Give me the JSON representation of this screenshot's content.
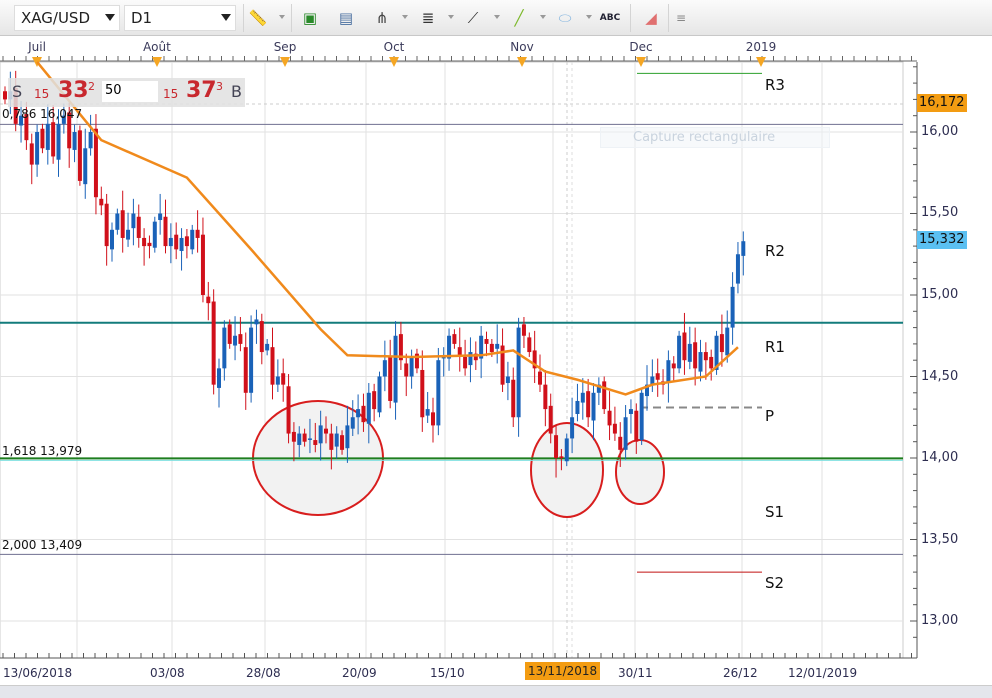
{
  "toolbar": {
    "symbol": "XAG/USD",
    "timeframe": "D1",
    "icons": [
      "ruler-icon",
      "add-image-icon",
      "chart-window-icon",
      "fork-icon",
      "indicator-list-icon",
      "fan-icon",
      "line-tool-icon",
      "ellipse-icon",
      "text-tool-icon",
      "eraser-icon",
      "menu-icon"
    ]
  },
  "months": [
    "Juil",
    "Août",
    "Sep",
    "Oct",
    "Nov",
    "Dec",
    "2019"
  ],
  "info_panel": {
    "sell_label": "S",
    "sell_big_prefix": "15",
    "sell_big": "33",
    "sell_sup": "2",
    "lot": "50",
    "buy_big_prefix": "15",
    "buy_big": "37",
    "buy_sup": "3",
    "buy_label": "B"
  },
  "overlay_hint": "Capture rectangulaire",
  "fib_labels": {
    "f0786": "0,786 16,047",
    "f1618": "1,618 13,979",
    "f2000": "2,000 13,409"
  },
  "pivot_labels": {
    "r3": "R3",
    "r2": "R2",
    "r1": "R1",
    "p": "P",
    "s1": "S1",
    "s2": "S2"
  },
  "price_badges": {
    "high": "16,172",
    "last": "15,332",
    "high_color": "#f39c12",
    "last_color": "#5bc0f2"
  },
  "selected_date": "13/11/2018",
  "colors": {
    "up": "#1a62b8",
    "down": "#d0101a",
    "ma": "#f08a1c",
    "r1_line": "#137c7c",
    "fib_green": "#1e7e1e",
    "circle": "#d81e1e"
  },
  "chart_data": {
    "type": "candlestick",
    "symbol": "XAG/USD",
    "timeframe": "D1",
    "ma_period": "50",
    "y_ticks": [
      "16,00",
      "15,50",
      "15,00",
      "14,50",
      "14,00",
      "13,50",
      "13,00"
    ],
    "x_ticks": [
      "13/06/2018",
      "03/08",
      "28/08",
      "20/09",
      "15/10",
      "13/11/2018",
      "30/11",
      "26/12",
      "12/01/2019"
    ],
    "ylim": [
      12.8,
      16.45
    ],
    "closes": [
      16.2,
      16.25,
      16.05,
      16.1,
      15.95,
      15.8,
      16.0,
      15.9,
      16.05,
      15.85,
      16.05,
      16.1,
      15.9,
      16.0,
      15.7,
      15.9,
      16.0,
      15.6,
      15.55,
      15.3,
      15.4,
      15.5,
      15.35,
      15.4,
      15.5,
      15.35,
      15.3,
      15.3,
      15.45,
      15.5,
      15.3,
      15.35,
      15.28,
      15.35,
      15.3,
      15.4,
      15.35,
      15.0,
      14.95,
      14.45,
      14.55,
      14.8,
      14.7,
      14.75,
      14.7,
      14.4,
      14.8,
      14.85,
      14.65,
      14.7,
      14.45,
      14.5,
      14.45,
      14.15,
      14.1,
      14.15,
      14.1,
      14.12,
      14.08,
      14.2,
      14.15,
      14.05,
      14.15,
      14.05,
      14.2,
      14.25,
      14.3,
      14.22,
      14.4,
      14.3,
      14.5,
      14.6,
      14.35,
      14.75,
      14.6,
      14.5,
      14.62,
      14.55,
      14.25,
      14.3,
      14.2,
      14.6,
      14.62,
      14.75,
      14.7,
      14.62,
      14.55,
      14.65,
      14.6,
      14.75,
      14.7,
      14.65,
      14.7,
      14.45,
      14.5,
      14.25,
      14.8,
      14.75,
      14.65,
      14.55,
      14.45,
      14.3,
      14.15,
      14.0,
      14.0,
      14.12,
      14.25,
      14.35,
      14.4,
      14.25,
      14.4,
      14.45,
      14.3,
      14.2,
      14.15,
      14.05,
      14.25,
      14.3,
      14.1,
      14.4,
      14.45,
      14.5,
      14.48,
      14.45,
      14.6,
      14.55,
      14.75,
      14.6,
      14.7,
      14.55,
      14.65,
      14.6,
      14.55,
      14.75,
      14.65,
      14.8,
      15.05,
      15.25,
      15.33
    ],
    "moving_average": [
      [
        6,
        16.43
      ],
      [
        18,
        15.95
      ],
      [
        34,
        15.72
      ],
      [
        46,
        15.28
      ],
      [
        59,
        14.79
      ],
      [
        64,
        14.63
      ],
      [
        76,
        14.62
      ],
      [
        89,
        14.63
      ],
      [
        95,
        14.66
      ],
      [
        101,
        14.53
      ],
      [
        107,
        14.48
      ],
      [
        116,
        14.39
      ],
      [
        121,
        14.45
      ],
      [
        131,
        14.5
      ],
      [
        137,
        14.68
      ]
    ],
    "levels": {
      "fib_0786": 16.047,
      "fib_1618": 13.979,
      "fib_2000": 13.409,
      "r3": 16.36,
      "r2": 15.33,
      "r1": 14.83,
      "p": 14.31,
      "s1": 13.7,
      "s2": 13.3
    },
    "highlighted_prices": [
      16.172,
      15.332
    ]
  }
}
